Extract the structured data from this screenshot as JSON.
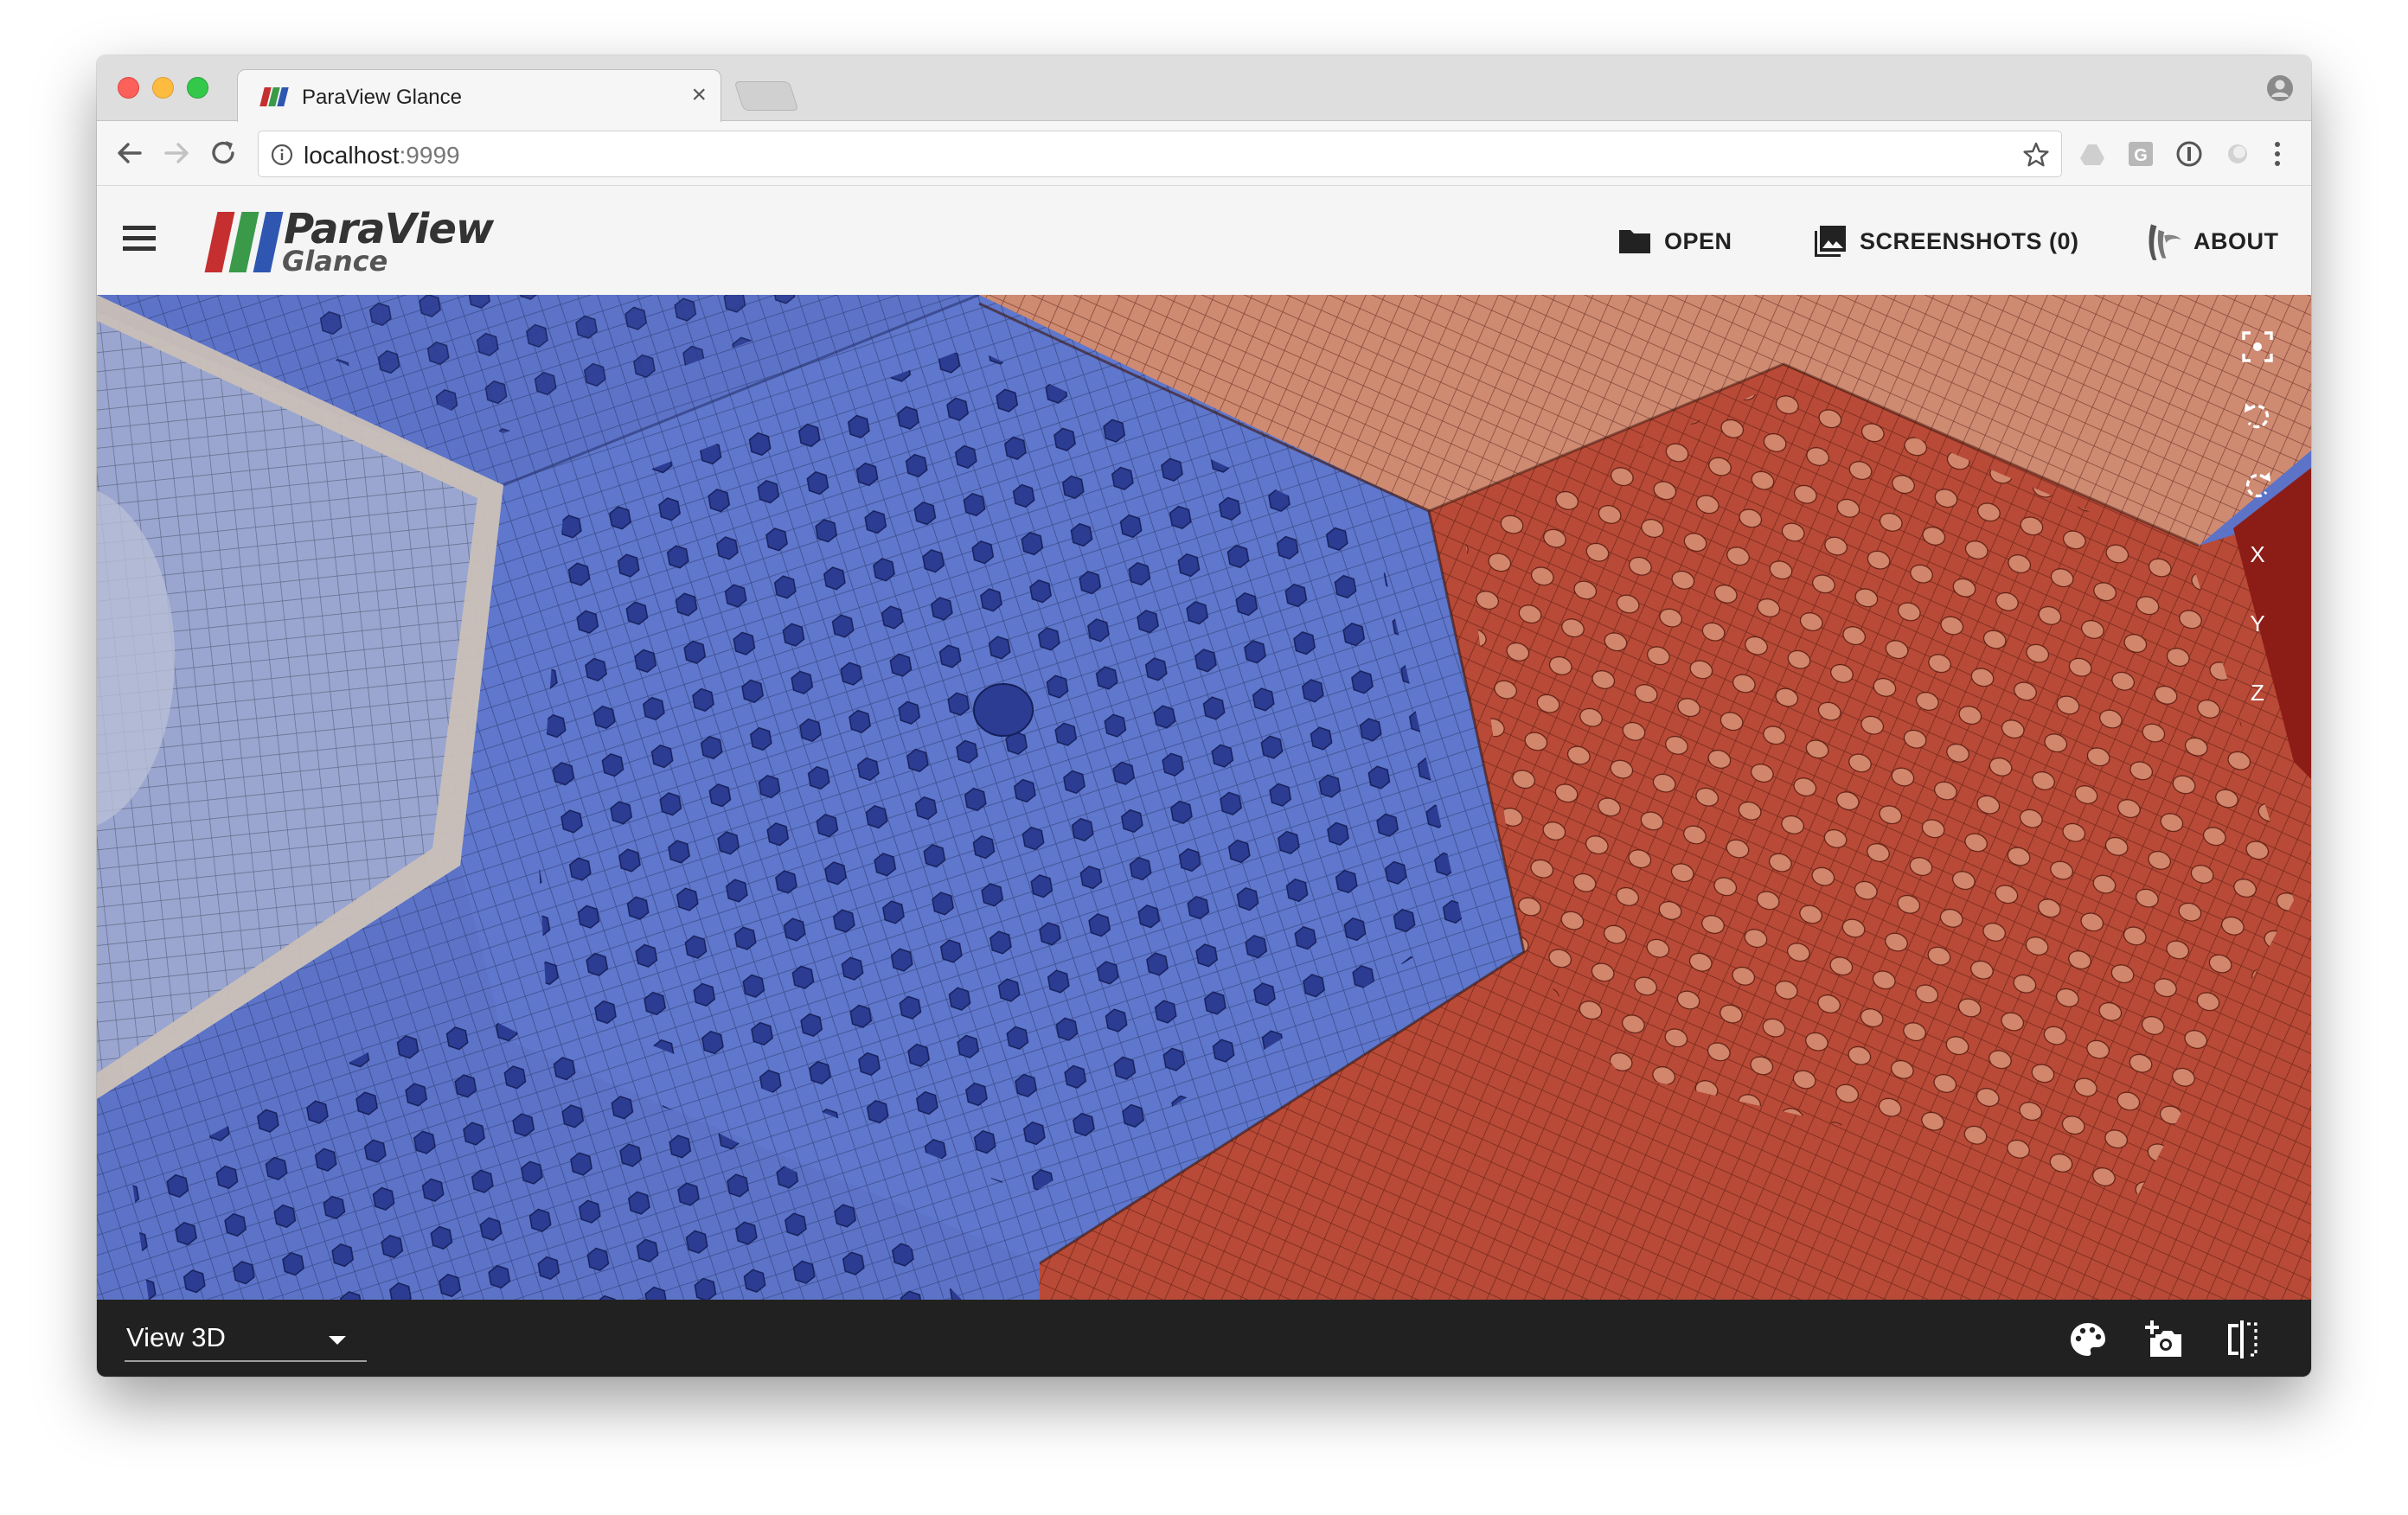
{
  "browser": {
    "tab_title": "ParaView Glance",
    "tab_close": "×",
    "url_host": "localhost",
    "url_port": ":9999"
  },
  "app": {
    "logo_line1": "ParaView",
    "logo_line2": "Glance",
    "header": {
      "open_label": "OPEN",
      "screenshots_label": "SCREENSHOTS (0)",
      "about_label": "ABOUT"
    },
    "viewport_tools": {
      "x_label": "X",
      "y_label": "Y",
      "z_label": "Z"
    },
    "footer": {
      "view_select_value": "View 3D"
    }
  },
  "colors": {
    "logo_red": "#c62f2f",
    "logo_green": "#3a9a4a",
    "logo_blue": "#2f56b0",
    "mesh_blue": "#5c73c8",
    "mesh_red": "#b84a37",
    "mesh_light_red": "#cf8a72",
    "mesh_grey_blue": "#9aa6cf",
    "footer_bg": "#212121"
  },
  "icons": {
    "hamburger": "menu-icon",
    "open": "folder-icon",
    "screenshots": "photo-library-icon",
    "about": "kitware-icon",
    "reset_camera": "center-focus-icon",
    "rotate_left": "rotate-left-icon",
    "rotate_right": "rotate-right-icon",
    "palette": "palette-icon",
    "screenshot": "add-camera-icon",
    "split": "split-view-icon"
  }
}
